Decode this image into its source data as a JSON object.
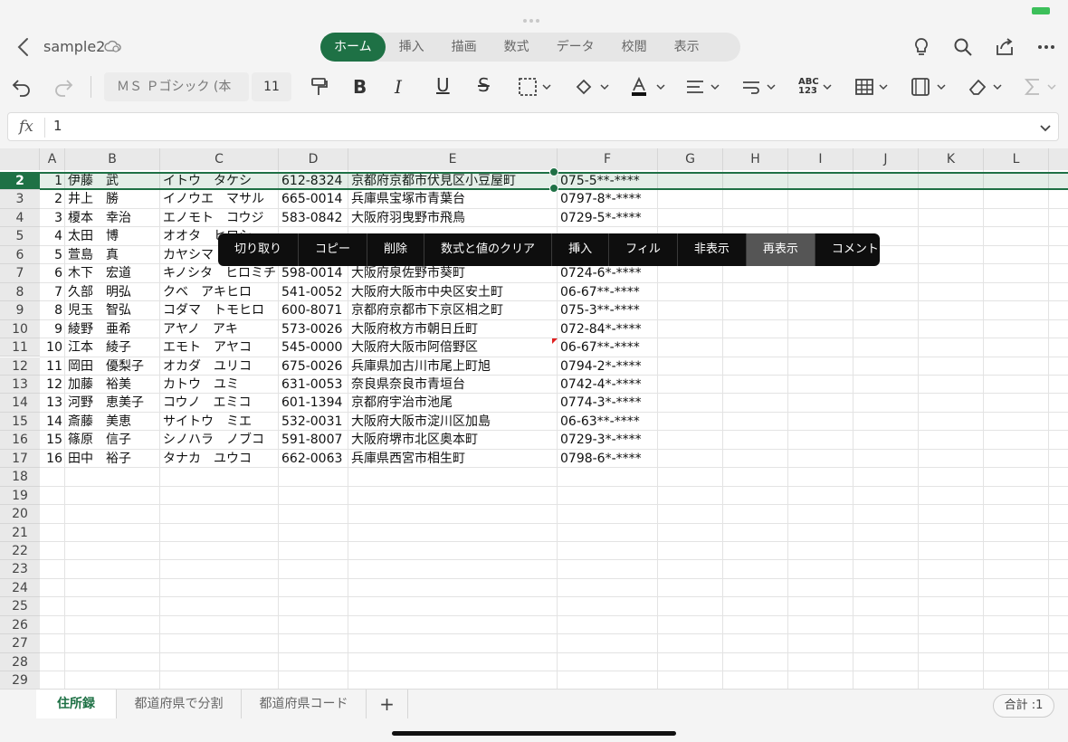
{
  "doc": {
    "title": "sample2"
  },
  "tabs": [
    "ホーム",
    "挿入",
    "描画",
    "数式",
    "データ",
    "校閲",
    "表示"
  ],
  "ribbon": {
    "font_name": "ＭＳ Ｐゴシック (本",
    "font_size": "11"
  },
  "formula": {
    "fx": "fx",
    "value": "1"
  },
  "columns": [
    "A",
    "B",
    "C",
    "D",
    "E",
    "F",
    "G",
    "H",
    "I",
    "J",
    "K",
    "L"
  ],
  "rows": [
    {
      "n": "2",
      "a": "1",
      "b": "伊藤　武",
      "c": "イトウ　タケシ",
      "d": "612-8324",
      "e": "京都府京都市伏見区小豆屋町",
      "f": "075-5**-****"
    },
    {
      "n": "3",
      "a": "2",
      "b": "井上　勝",
      "c": "イノウエ　マサル",
      "d": "665-0014",
      "e": "兵庫県宝塚市青葉台",
      "f": "0797-8*-****"
    },
    {
      "n": "4",
      "a": "3",
      "b": "榎本　幸治",
      "c": "エノモト　コウジ",
      "d": "583-0842",
      "e": "大阪府羽曳野市飛鳥",
      "f": "0729-5*-****"
    },
    {
      "n": "5",
      "a": "4",
      "b": "太田　博",
      "c": "オオタ　ヒロシ",
      "d": "",
      "e": "",
      "f": ""
    },
    {
      "n": "6",
      "a": "5",
      "b": "萱島　真",
      "c": "カヤシマ",
      "d": "",
      "e": "",
      "f": ""
    },
    {
      "n": "7",
      "a": "6",
      "b": "木下　宏道",
      "c": "キノシタ　ヒロミチ",
      "d": "598-0014",
      "e": "大阪府泉佐野市葵町",
      "f": "0724-6*-****"
    },
    {
      "n": "8",
      "a": "7",
      "b": "久部　明弘",
      "c": "クベ　アキヒロ",
      "d": "541-0052",
      "e": "大阪府大阪市中央区安土町",
      "f": "06-67**-****"
    },
    {
      "n": "9",
      "a": "8",
      "b": "児玉　智弘",
      "c": "コダマ　トモヒロ",
      "d": "600-8071",
      "e": "京都府京都市下京区相之町",
      "f": "075-3**-****"
    },
    {
      "n": "10",
      "a": "9",
      "b": "綾野　亜希",
      "c": "アヤノ　アキ",
      "d": "573-0026",
      "e": "大阪府枚方市朝日丘町",
      "f": "072-84*-****"
    },
    {
      "n": "11",
      "a": "10",
      "b": "江本　綾子",
      "c": "エモト　アヤコ",
      "d": "545-0000",
      "e": "大阪府大阪市阿倍野区",
      "f": "06-67**-****"
    },
    {
      "n": "12",
      "a": "11",
      "b": "岡田　優梨子",
      "c": "オカダ　ユリコ",
      "d": "675-0026",
      "e": "兵庫県加古川市尾上町旭",
      "f": "0794-2*-****"
    },
    {
      "n": "13",
      "a": "12",
      "b": "加藤　裕美",
      "c": "カトウ　ユミ",
      "d": "631-0053",
      "e": "奈良県奈良市青垣台",
      "f": "0742-4*-****"
    },
    {
      "n": "14",
      "a": "13",
      "b": "河野　恵美子",
      "c": "コウノ　エミコ",
      "d": "601-1394",
      "e": "京都府宇治市池尾",
      "f": "0774-3*-****"
    },
    {
      "n": "15",
      "a": "14",
      "b": "斎藤　美恵",
      "c": "サイトウ　ミエ",
      "d": "532-0031",
      "e": "大阪府大阪市淀川区加島",
      "f": "06-63**-****"
    },
    {
      "n": "16",
      "a": "15",
      "b": "篠原　信子",
      "c": "シノハラ　ノブコ",
      "d": "591-8007",
      "e": "大阪府堺市北区奥本町",
      "f": "0729-3*-****"
    },
    {
      "n": "17",
      "a": "16",
      "b": "田中　裕子",
      "c": "タナカ　ユウコ",
      "d": "662-0063",
      "e": "兵庫県西宮市相生町",
      "f": "0798-6*-****"
    },
    {
      "n": "18",
      "a": "",
      "b": "",
      "c": "",
      "d": "",
      "e": "",
      "f": ""
    },
    {
      "n": "19",
      "a": "",
      "b": "",
      "c": "",
      "d": "",
      "e": "",
      "f": ""
    },
    {
      "n": "20",
      "a": "",
      "b": "",
      "c": "",
      "d": "",
      "e": "",
      "f": ""
    },
    {
      "n": "21",
      "a": "",
      "b": "",
      "c": "",
      "d": "",
      "e": "",
      "f": ""
    },
    {
      "n": "22",
      "a": "",
      "b": "",
      "c": "",
      "d": "",
      "e": "",
      "f": ""
    },
    {
      "n": "23",
      "a": "",
      "b": "",
      "c": "",
      "d": "",
      "e": "",
      "f": ""
    },
    {
      "n": "24",
      "a": "",
      "b": "",
      "c": "",
      "d": "",
      "e": "",
      "f": ""
    },
    {
      "n": "25",
      "a": "",
      "b": "",
      "c": "",
      "d": "",
      "e": "",
      "f": ""
    },
    {
      "n": "26",
      "a": "",
      "b": "",
      "c": "",
      "d": "",
      "e": "",
      "f": ""
    },
    {
      "n": "27",
      "a": "",
      "b": "",
      "c": "",
      "d": "",
      "e": "",
      "f": ""
    },
    {
      "n": "28",
      "a": "",
      "b": "",
      "c": "",
      "d": "",
      "e": "",
      "f": ""
    },
    {
      "n": "29",
      "a": "",
      "b": "",
      "c": "",
      "d": "",
      "e": "",
      "f": ""
    }
  ],
  "context_menu": [
    "切り取り",
    "コピー",
    "削除",
    "数式と値のクリア",
    "挿入",
    "フィル",
    "非表示",
    "再表示",
    "コメント"
  ],
  "context_menu_highlighted": "再表示",
  "sheets": [
    "住所録",
    "都道府県で分割",
    "都道府県コード"
  ],
  "add_sheet": "+",
  "status": {
    "sum": "合計 :1"
  },
  "colors": {
    "accent": "#1e7145",
    "menu_bg": "#0e0e0e",
    "battery": "#3cbf5a"
  }
}
